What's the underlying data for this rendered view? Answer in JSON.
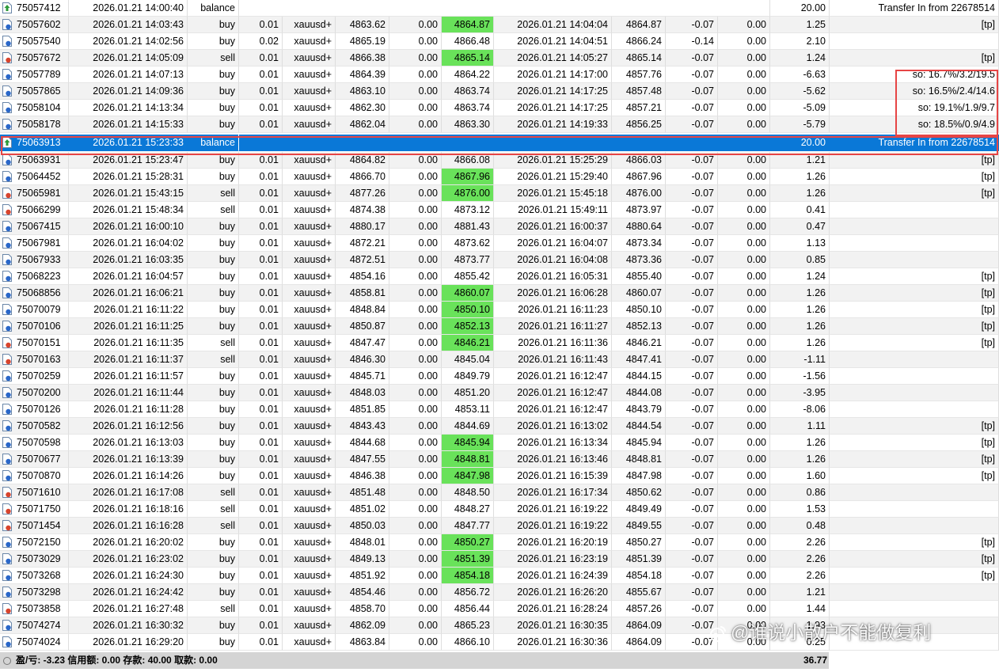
{
  "columns": [
    "ticket",
    "open_time",
    "type",
    "volume",
    "symbol",
    "open_price",
    "sl",
    "tp",
    "close_time",
    "close_price",
    "commission",
    "swap",
    "profit",
    "comment"
  ],
  "rows": [
    {
      "ticket": "75057412",
      "open_time": "2026.01.21 14:00:40",
      "type": "balance",
      "profit": "20.00",
      "comment": "Transfer In from 22678514"
    },
    {
      "ticket": "75057602",
      "open_time": "2026.01.21 14:03:43",
      "type": "buy",
      "volume": "0.01",
      "symbol": "xauusd+",
      "open_price": "4863.62",
      "sl": "0.00",
      "tp": "4864.87",
      "close_time": "2026.01.21 14:04:04",
      "close_price": "4864.87",
      "commission": "-0.07",
      "swap": "0.00",
      "profit": "1.25",
      "comment": "[tp]",
      "tp_hit": true
    },
    {
      "ticket": "75057540",
      "open_time": "2026.01.21 14:02:56",
      "type": "buy",
      "volume": "0.02",
      "symbol": "xauusd+",
      "open_price": "4865.19",
      "sl": "0.00",
      "tp": "4866.48",
      "close_time": "2026.01.21 14:04:51",
      "close_price": "4866.24",
      "commission": "-0.14",
      "swap": "0.00",
      "profit": "2.10",
      "comment": ""
    },
    {
      "ticket": "75057672",
      "open_time": "2026.01.21 14:05:09",
      "type": "sell",
      "volume": "0.01",
      "symbol": "xauusd+",
      "open_price": "4866.38",
      "sl": "0.00",
      "tp": "4865.14",
      "close_time": "2026.01.21 14:05:27",
      "close_price": "4865.14",
      "commission": "-0.07",
      "swap": "0.00",
      "profit": "1.24",
      "comment": "[tp]",
      "tp_hit": true
    },
    {
      "ticket": "75057789",
      "open_time": "2026.01.21 14:07:13",
      "type": "buy",
      "volume": "0.01",
      "symbol": "xauusd+",
      "open_price": "4864.39",
      "sl": "0.00",
      "tp": "4864.22",
      "close_time": "2026.01.21 14:17:00",
      "close_price": "4857.76",
      "commission": "-0.07",
      "swap": "0.00",
      "profit": "-6.63",
      "comment": "so: 16.7%/3.2/19.5"
    },
    {
      "ticket": "75057865",
      "open_time": "2026.01.21 14:09:36",
      "type": "buy",
      "volume": "0.01",
      "symbol": "xauusd+",
      "open_price": "4863.10",
      "sl": "0.00",
      "tp": "4863.74",
      "close_time": "2026.01.21 14:17:25",
      "close_price": "4857.48",
      "commission": "-0.07",
      "swap": "0.00",
      "profit": "-5.62",
      "comment": "so: 16.5%/2.4/14.6"
    },
    {
      "ticket": "75058104",
      "open_time": "2026.01.21 14:13:34",
      "type": "buy",
      "volume": "0.01",
      "symbol": "xauusd+",
      "open_price": "4862.30",
      "sl": "0.00",
      "tp": "4863.74",
      "close_time": "2026.01.21 14:17:25",
      "close_price": "4857.21",
      "commission": "-0.07",
      "swap": "0.00",
      "profit": "-5.09",
      "comment": "so: 19.1%/1.9/9.7"
    },
    {
      "ticket": "75058178",
      "open_time": "2026.01.21 14:15:33",
      "type": "buy",
      "volume": "0.01",
      "symbol": "xauusd+",
      "open_price": "4862.04",
      "sl": "0.00",
      "tp": "4863.30",
      "close_time": "2026.01.21 14:19:33",
      "close_price": "4856.25",
      "commission": "-0.07",
      "swap": "0.00",
      "profit": "-5.79",
      "comment": "so: 18.5%/0.9/4.9"
    },
    {
      "ticket": "75063913",
      "open_time": "2026.01.21 15:23:33",
      "type": "balance",
      "profit": "20.00",
      "comment": "Transfer In from 22678514",
      "selected": true
    },
    {
      "ticket": "75063931",
      "open_time": "2026.01.21 15:23:47",
      "type": "buy",
      "volume": "0.01",
      "symbol": "xauusd+",
      "open_price": "4864.82",
      "sl": "0.00",
      "tp": "4866.08",
      "close_time": "2026.01.21 15:25:29",
      "close_price": "4866.03",
      "commission": "-0.07",
      "swap": "0.00",
      "profit": "1.21",
      "comment": "[tp]"
    },
    {
      "ticket": "75064452",
      "open_time": "2026.01.21 15:28:31",
      "type": "buy",
      "volume": "0.01",
      "symbol": "xauusd+",
      "open_price": "4866.70",
      "sl": "0.00",
      "tp": "4867.96",
      "close_time": "2026.01.21 15:29:40",
      "close_price": "4867.96",
      "commission": "-0.07",
      "swap": "0.00",
      "profit": "1.26",
      "comment": "[tp]",
      "tp_hit": true
    },
    {
      "ticket": "75065981",
      "open_time": "2026.01.21 15:43:15",
      "type": "sell",
      "volume": "0.01",
      "symbol": "xauusd+",
      "open_price": "4877.26",
      "sl": "0.00",
      "tp": "4876.00",
      "close_time": "2026.01.21 15:45:18",
      "close_price": "4876.00",
      "commission": "-0.07",
      "swap": "0.00",
      "profit": "1.26",
      "comment": "[tp]",
      "tp_hit": true
    },
    {
      "ticket": "75066299",
      "open_time": "2026.01.21 15:48:34",
      "type": "sell",
      "volume": "0.01",
      "symbol": "xauusd+",
      "open_price": "4874.38",
      "sl": "0.00",
      "tp": "4873.12",
      "close_time": "2026.01.21 15:49:11",
      "close_price": "4873.97",
      "commission": "-0.07",
      "swap": "0.00",
      "profit": "0.41",
      "comment": ""
    },
    {
      "ticket": "75067415",
      "open_time": "2026.01.21 16:00:10",
      "type": "buy",
      "volume": "0.01",
      "symbol": "xauusd+",
      "open_price": "4880.17",
      "sl": "0.00",
      "tp": "4881.43",
      "close_time": "2026.01.21 16:00:37",
      "close_price": "4880.64",
      "commission": "-0.07",
      "swap": "0.00",
      "profit": "0.47",
      "comment": ""
    },
    {
      "ticket": "75067981",
      "open_time": "2026.01.21 16:04:02",
      "type": "buy",
      "volume": "0.01",
      "symbol": "xauusd+",
      "open_price": "4872.21",
      "sl": "0.00",
      "tp": "4873.62",
      "close_time": "2026.01.21 16:04:07",
      "close_price": "4873.34",
      "commission": "-0.07",
      "swap": "0.00",
      "profit": "1.13",
      "comment": ""
    },
    {
      "ticket": "75067933",
      "open_time": "2026.01.21 16:03:35",
      "type": "buy",
      "volume": "0.01",
      "symbol": "xauusd+",
      "open_price": "4872.51",
      "sl": "0.00",
      "tp": "4873.77",
      "close_time": "2026.01.21 16:04:08",
      "close_price": "4873.36",
      "commission": "-0.07",
      "swap": "0.00",
      "profit": "0.85",
      "comment": ""
    },
    {
      "ticket": "75068223",
      "open_time": "2026.01.21 16:04:57",
      "type": "buy",
      "volume": "0.01",
      "symbol": "xauusd+",
      "open_price": "4854.16",
      "sl": "0.00",
      "tp": "4855.42",
      "close_time": "2026.01.21 16:05:31",
      "close_price": "4855.40",
      "commission": "-0.07",
      "swap": "0.00",
      "profit": "1.24",
      "comment": "[tp]"
    },
    {
      "ticket": "75068856",
      "open_time": "2026.01.21 16:06:21",
      "type": "buy",
      "volume": "0.01",
      "symbol": "xauusd+",
      "open_price": "4858.81",
      "sl": "0.00",
      "tp": "4860.07",
      "close_time": "2026.01.21 16:06:28",
      "close_price": "4860.07",
      "commission": "-0.07",
      "swap": "0.00",
      "profit": "1.26",
      "comment": "[tp]",
      "tp_hit": true
    },
    {
      "ticket": "75070079",
      "open_time": "2026.01.21 16:11:22",
      "type": "buy",
      "volume": "0.01",
      "symbol": "xauusd+",
      "open_price": "4848.84",
      "sl": "0.00",
      "tp": "4850.10",
      "close_time": "2026.01.21 16:11:23",
      "close_price": "4850.10",
      "commission": "-0.07",
      "swap": "0.00",
      "profit": "1.26",
      "comment": "[tp]",
      "tp_hit": true
    },
    {
      "ticket": "75070106",
      "open_time": "2026.01.21 16:11:25",
      "type": "buy",
      "volume": "0.01",
      "symbol": "xauusd+",
      "open_price": "4850.87",
      "sl": "0.00",
      "tp": "4852.13",
      "close_time": "2026.01.21 16:11:27",
      "close_price": "4852.13",
      "commission": "-0.07",
      "swap": "0.00",
      "profit": "1.26",
      "comment": "[tp]",
      "tp_hit": true
    },
    {
      "ticket": "75070151",
      "open_time": "2026.01.21 16:11:35",
      "type": "sell",
      "volume": "0.01",
      "symbol": "xauusd+",
      "open_price": "4847.47",
      "sl": "0.00",
      "tp": "4846.21",
      "close_time": "2026.01.21 16:11:36",
      "close_price": "4846.21",
      "commission": "-0.07",
      "swap": "0.00",
      "profit": "1.26",
      "comment": "[tp]",
      "tp_hit": true
    },
    {
      "ticket": "75070163",
      "open_time": "2026.01.21 16:11:37",
      "type": "sell",
      "volume": "0.01",
      "symbol": "xauusd+",
      "open_price": "4846.30",
      "sl": "0.00",
      "tp": "4845.04",
      "close_time": "2026.01.21 16:11:43",
      "close_price": "4847.41",
      "commission": "-0.07",
      "swap": "0.00",
      "profit": "-1.11",
      "comment": ""
    },
    {
      "ticket": "75070259",
      "open_time": "2026.01.21 16:11:57",
      "type": "buy",
      "volume": "0.01",
      "symbol": "xauusd+",
      "open_price": "4845.71",
      "sl": "0.00",
      "tp": "4849.79",
      "close_time": "2026.01.21 16:12:47",
      "close_price": "4844.15",
      "commission": "-0.07",
      "swap": "0.00",
      "profit": "-1.56",
      "comment": ""
    },
    {
      "ticket": "75070200",
      "open_time": "2026.01.21 16:11:44",
      "type": "buy",
      "volume": "0.01",
      "symbol": "xauusd+",
      "open_price": "4848.03",
      "sl": "0.00",
      "tp": "4851.20",
      "close_time": "2026.01.21 16:12:47",
      "close_price": "4844.08",
      "commission": "-0.07",
      "swap": "0.00",
      "profit": "-3.95",
      "comment": ""
    },
    {
      "ticket": "75070126",
      "open_time": "2026.01.21 16:11:28",
      "type": "buy",
      "volume": "0.01",
      "symbol": "xauusd+",
      "open_price": "4851.85",
      "sl": "0.00",
      "tp": "4853.11",
      "close_time": "2026.01.21 16:12:47",
      "close_price": "4843.79",
      "commission": "-0.07",
      "swap": "0.00",
      "profit": "-8.06",
      "comment": ""
    },
    {
      "ticket": "75070582",
      "open_time": "2026.01.21 16:12:56",
      "type": "buy",
      "volume": "0.01",
      "symbol": "xauusd+",
      "open_price": "4843.43",
      "sl": "0.00",
      "tp": "4844.69",
      "close_time": "2026.01.21 16:13:02",
      "close_price": "4844.54",
      "commission": "-0.07",
      "swap": "0.00",
      "profit": "1.11",
      "comment": "[tp]"
    },
    {
      "ticket": "75070598",
      "open_time": "2026.01.21 16:13:03",
      "type": "buy",
      "volume": "0.01",
      "symbol": "xauusd+",
      "open_price": "4844.68",
      "sl": "0.00",
      "tp": "4845.94",
      "close_time": "2026.01.21 16:13:34",
      "close_price": "4845.94",
      "commission": "-0.07",
      "swap": "0.00",
      "profit": "1.26",
      "comment": "[tp]",
      "tp_hit": true
    },
    {
      "ticket": "75070677",
      "open_time": "2026.01.21 16:13:39",
      "type": "buy",
      "volume": "0.01",
      "symbol": "xauusd+",
      "open_price": "4847.55",
      "sl": "0.00",
      "tp": "4848.81",
      "close_time": "2026.01.21 16:13:46",
      "close_price": "4848.81",
      "commission": "-0.07",
      "swap": "0.00",
      "profit": "1.26",
      "comment": "[tp]",
      "tp_hit": true
    },
    {
      "ticket": "75070870",
      "open_time": "2026.01.21 16:14:26",
      "type": "buy",
      "volume": "0.01",
      "symbol": "xauusd+",
      "open_price": "4846.38",
      "sl": "0.00",
      "tp": "4847.98",
      "close_time": "2026.01.21 16:15:39",
      "close_price": "4847.98",
      "commission": "-0.07",
      "swap": "0.00",
      "profit": "1.60",
      "comment": "[tp]",
      "tp_hit": true
    },
    {
      "ticket": "75071610",
      "open_time": "2026.01.21 16:17:08",
      "type": "sell",
      "volume": "0.01",
      "symbol": "xauusd+",
      "open_price": "4851.48",
      "sl": "0.00",
      "tp": "4848.50",
      "close_time": "2026.01.21 16:17:34",
      "close_price": "4850.62",
      "commission": "-0.07",
      "swap": "0.00",
      "profit": "0.86",
      "comment": ""
    },
    {
      "ticket": "75071750",
      "open_time": "2026.01.21 16:18:16",
      "type": "sell",
      "volume": "0.01",
      "symbol": "xauusd+",
      "open_price": "4851.02",
      "sl": "0.00",
      "tp": "4848.27",
      "close_time": "2026.01.21 16:19:22",
      "close_price": "4849.49",
      "commission": "-0.07",
      "swap": "0.00",
      "profit": "1.53",
      "comment": ""
    },
    {
      "ticket": "75071454",
      "open_time": "2026.01.21 16:16:28",
      "type": "sell",
      "volume": "0.01",
      "symbol": "xauusd+",
      "open_price": "4850.03",
      "sl": "0.00",
      "tp": "4847.77",
      "close_time": "2026.01.21 16:19:22",
      "close_price": "4849.55",
      "commission": "-0.07",
      "swap": "0.00",
      "profit": "0.48",
      "comment": ""
    },
    {
      "ticket": "75072150",
      "open_time": "2026.01.21 16:20:02",
      "type": "buy",
      "volume": "0.01",
      "symbol": "xauusd+",
      "open_price": "4848.01",
      "sl": "0.00",
      "tp": "4850.27",
      "close_time": "2026.01.21 16:20:19",
      "close_price": "4850.27",
      "commission": "-0.07",
      "swap": "0.00",
      "profit": "2.26",
      "comment": "[tp]",
      "tp_hit": true
    },
    {
      "ticket": "75073029",
      "open_time": "2026.01.21 16:23:02",
      "type": "buy",
      "volume": "0.01",
      "symbol": "xauusd+",
      "open_price": "4849.13",
      "sl": "0.00",
      "tp": "4851.39",
      "close_time": "2026.01.21 16:23:19",
      "close_price": "4851.39",
      "commission": "-0.07",
      "swap": "0.00",
      "profit": "2.26",
      "comment": "[tp]",
      "tp_hit": true
    },
    {
      "ticket": "75073268",
      "open_time": "2026.01.21 16:24:30",
      "type": "buy",
      "volume": "0.01",
      "symbol": "xauusd+",
      "open_price": "4851.92",
      "sl": "0.00",
      "tp": "4854.18",
      "close_time": "2026.01.21 16:24:39",
      "close_price": "4854.18",
      "commission": "-0.07",
      "swap": "0.00",
      "profit": "2.26",
      "comment": "[tp]",
      "tp_hit": true
    },
    {
      "ticket": "75073298",
      "open_time": "2026.01.21 16:24:42",
      "type": "buy",
      "volume": "0.01",
      "symbol": "xauusd+",
      "open_price": "4854.46",
      "sl": "0.00",
      "tp": "4856.72",
      "close_time": "2026.01.21 16:26:20",
      "close_price": "4855.67",
      "commission": "-0.07",
      "swap": "0.00",
      "profit": "1.21",
      "comment": ""
    },
    {
      "ticket": "75073858",
      "open_time": "2026.01.21 16:27:48",
      "type": "sell",
      "volume": "0.01",
      "symbol": "xauusd+",
      "open_price": "4858.70",
      "sl": "0.00",
      "tp": "4856.44",
      "close_time": "2026.01.21 16:28:24",
      "close_price": "4857.26",
      "commission": "-0.07",
      "swap": "0.00",
      "profit": "1.44",
      "comment": ""
    },
    {
      "ticket": "75074274",
      "open_time": "2026.01.21 16:30:32",
      "type": "buy",
      "volume": "0.01",
      "symbol": "xauusd+",
      "open_price": "4862.09",
      "sl": "0.00",
      "tp": "4865.23",
      "close_time": "2026.01.21 16:30:35",
      "close_price": "4864.09",
      "commission": "-0.07",
      "swap": "0.00",
      "profit": "1.93",
      "comment": ""
    },
    {
      "ticket": "75074024",
      "open_time": "2026.01.21 16:29:20",
      "type": "buy",
      "volume": "0.01",
      "symbol": "xauusd+",
      "open_price": "4863.84",
      "sl": "0.00",
      "tp": "4866.10",
      "close_time": "2026.01.21 16:30:36",
      "close_price": "4864.09",
      "commission": "-0.07",
      "swap": "0.00",
      "profit": "0.25",
      "comment": ""
    }
  ],
  "footer": {
    "summary": "盈/亏: -3.23  信用额: 0.00  存款: 40.00  取款: 0.00",
    "total": "36.77"
  },
  "watermark": "@谁说小散户不能做复利",
  "colors": {
    "tp_hit": "#69e25a",
    "selected": "#0a78d7",
    "highlight_box": "#e64545",
    "icon_buy": "#2a67c9",
    "icon_sell": "#d8442d",
    "icon_balance": "#2c9a3a"
  }
}
